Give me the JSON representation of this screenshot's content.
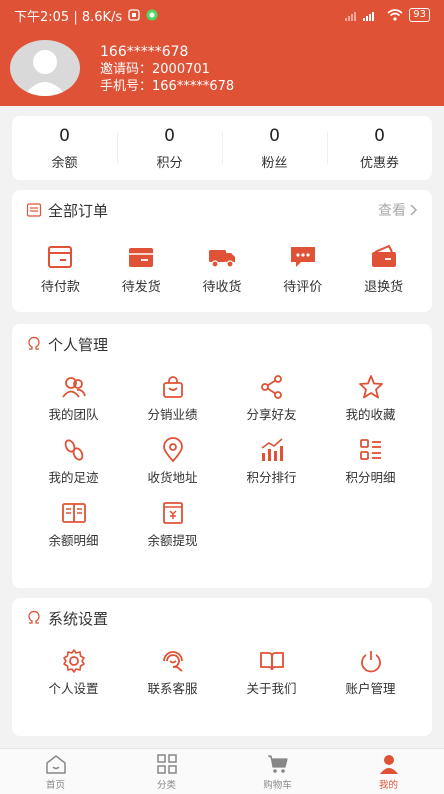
{
  "status_bar": {
    "time_text": "下午2:05 | 8.6K/s",
    "battery": "93"
  },
  "profile": {
    "name": "166*****678",
    "invite_code": "邀请码：2000701",
    "phone": "手机号：166*****678"
  },
  "stats": [
    {
      "value": "0",
      "label": "余额"
    },
    {
      "value": "0",
      "label": "积分"
    },
    {
      "value": "0",
      "label": "粉丝"
    },
    {
      "value": "0",
      "label": "优惠券"
    }
  ],
  "orders": {
    "title": "全部订单",
    "view_more": "查看",
    "items": [
      {
        "label": "待付款",
        "icon": "wallet-icon"
      },
      {
        "label": "待发货",
        "icon": "box-icon"
      },
      {
        "label": "待收货",
        "icon": "truck-icon"
      },
      {
        "label": "待评价",
        "icon": "comment-icon"
      },
      {
        "label": "退换货",
        "icon": "return-icon"
      }
    ]
  },
  "personal": {
    "title": "个人管理",
    "items": [
      {
        "label": "我的团队",
        "icon": "team-icon"
      },
      {
        "label": "分销业绩",
        "icon": "bag-icon"
      },
      {
        "label": "分享好友",
        "icon": "share-icon"
      },
      {
        "label": "我的收藏",
        "icon": "star-icon"
      },
      {
        "label": "我的足迹",
        "icon": "footprint-icon"
      },
      {
        "label": "收货地址",
        "icon": "location-icon"
      },
      {
        "label": "积分排行",
        "icon": "ranking-icon"
      },
      {
        "label": "积分明细",
        "icon": "list-icon"
      },
      {
        "label": "余额明细",
        "icon": "book-icon"
      },
      {
        "label": "余额提现",
        "icon": "withdraw-icon"
      }
    ]
  },
  "settings": {
    "title": "系统设置",
    "items": [
      {
        "label": "个人设置",
        "icon": "gear-icon"
      },
      {
        "label": "联系客服",
        "icon": "service-icon"
      },
      {
        "label": "关于我们",
        "icon": "open-book-icon"
      },
      {
        "label": "账户管理",
        "icon": "power-icon"
      }
    ]
  },
  "tabbar": [
    {
      "label": "首页",
      "icon": "home-icon"
    },
    {
      "label": "分类",
      "icon": "category-icon"
    },
    {
      "label": "购物车",
      "icon": "cart-icon"
    },
    {
      "label": "我的",
      "icon": "user-icon",
      "active": true
    }
  ],
  "colors": {
    "accent": "#e05236",
    "background": "#f2f2f2"
  }
}
